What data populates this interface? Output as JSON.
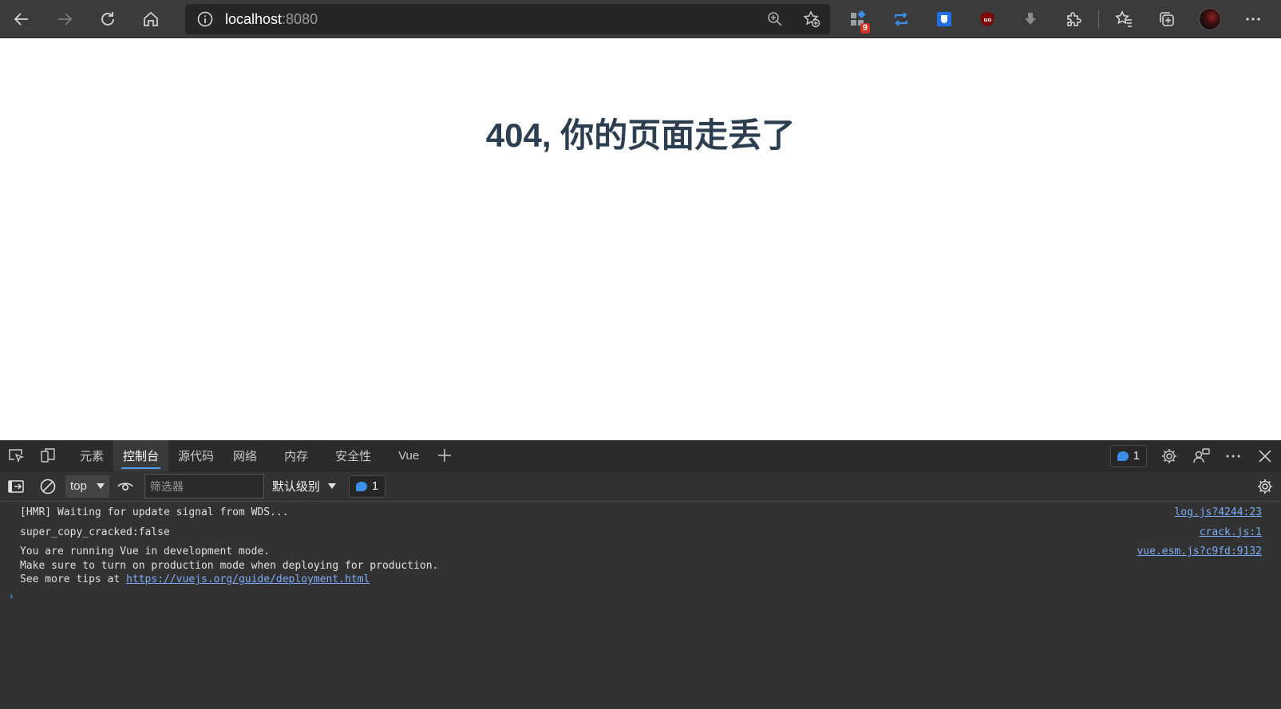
{
  "browser": {
    "url_host": "localhost",
    "url_port": ":8080",
    "extension_badge": "9"
  },
  "page": {
    "heading": "404, 你的页面走丢了"
  },
  "devtools": {
    "tabs": [
      "元素",
      "控制台",
      "源代码",
      "网络",
      "内存",
      "安全性",
      "Vue"
    ],
    "active_tab": "控制台",
    "message_count": "1",
    "context": "top",
    "filter_placeholder": "筛选器",
    "log_level": "默认级别",
    "filter_message_count": "1",
    "logs": [
      {
        "lines": [
          "[HMR] Waiting for update signal from WDS..."
        ],
        "source": "log.js?4244:23"
      },
      {
        "lines": [
          "super_copy_cracked:false"
        ],
        "source": "crack.js:1"
      },
      {
        "lines": [
          "You are running Vue in development mode.",
          "Make sure to turn on production mode when deploying for production."
        ],
        "line3_prefix": "See more tips at ",
        "line3_link": "https://vuejs.org/guide/deployment.html",
        "source": "vue.esm.js?c9fd:9132"
      }
    ],
    "prompt_symbol": "›"
  }
}
